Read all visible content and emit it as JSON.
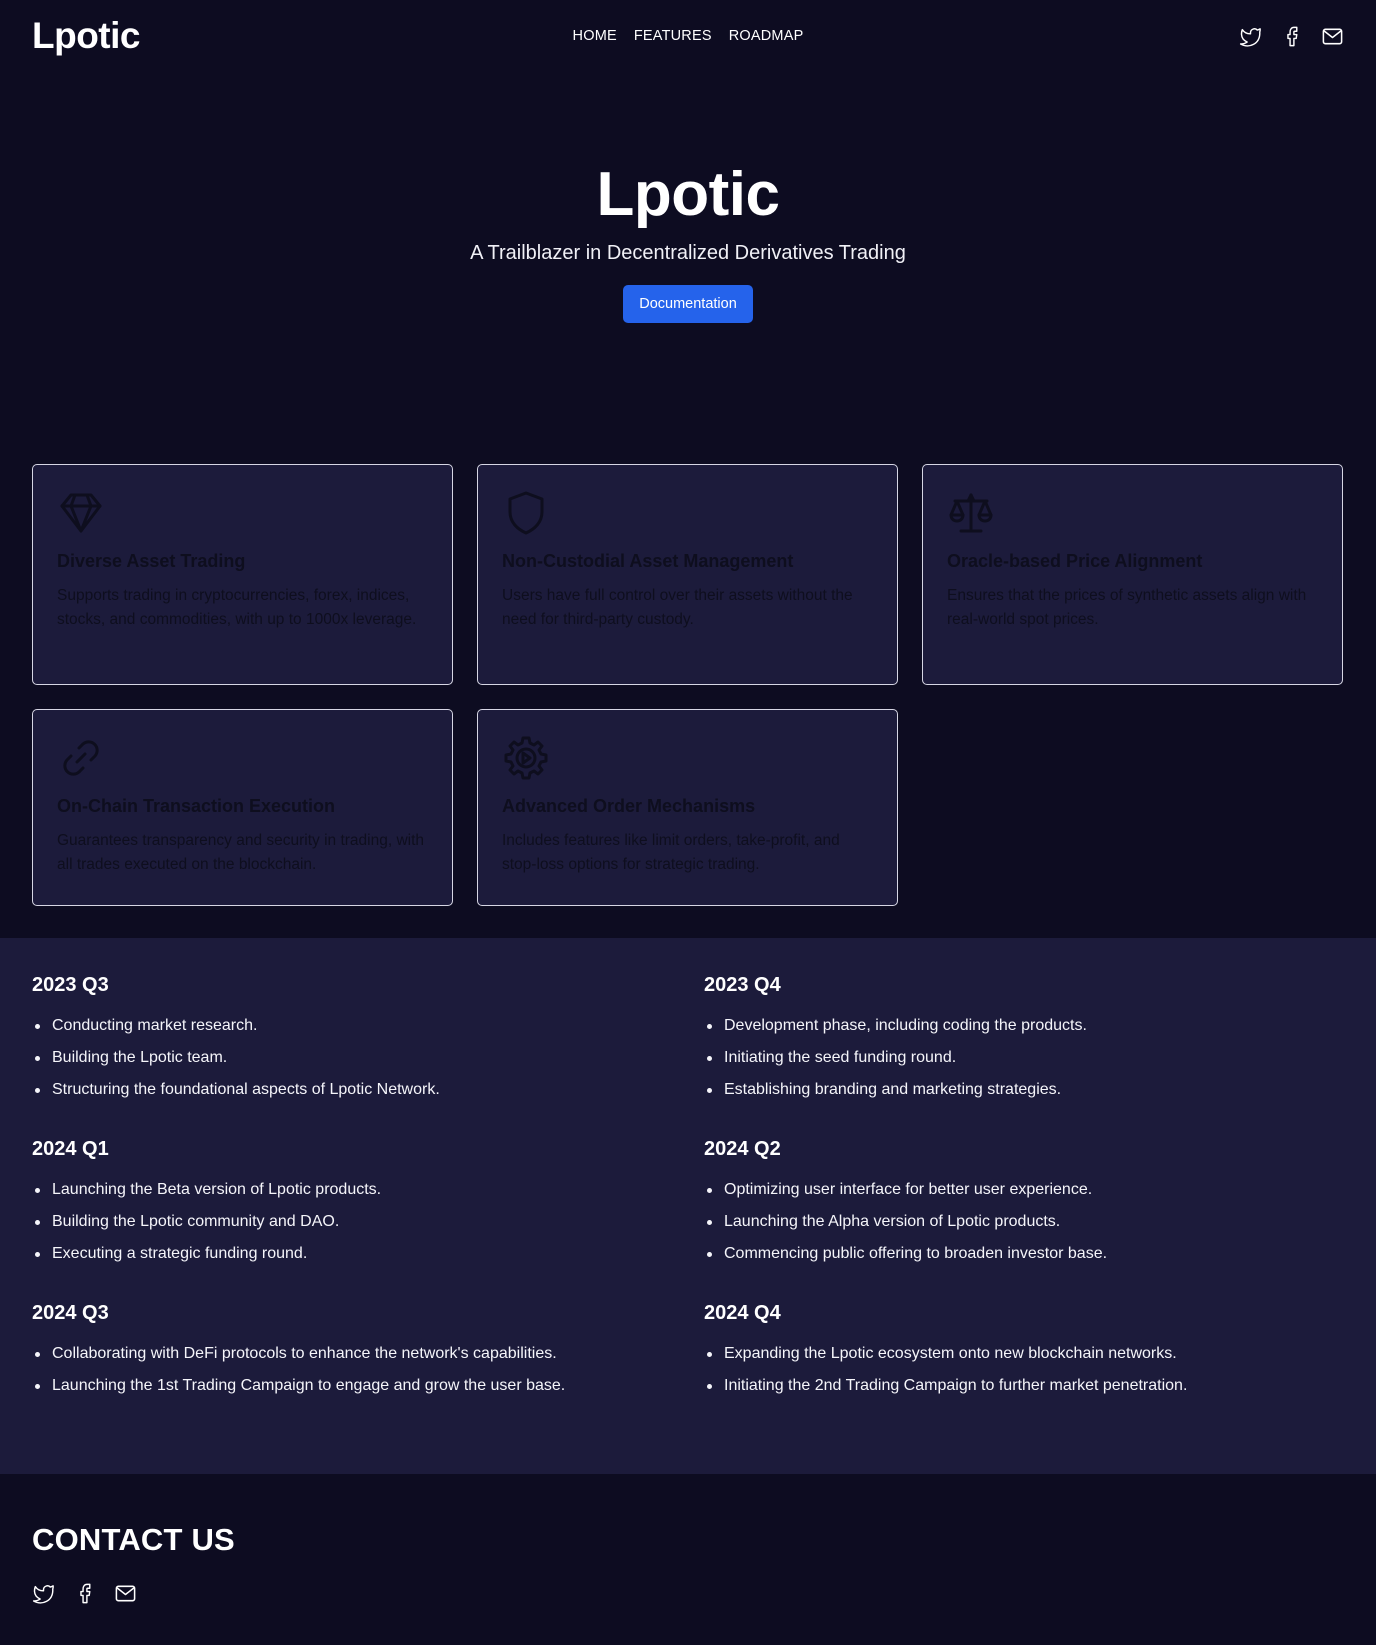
{
  "brand": {
    "logo": "Lpotic"
  },
  "nav": {
    "items": [
      {
        "label": "HOME"
      },
      {
        "label": "FEATURES"
      },
      {
        "label": "ROADMAP"
      }
    ]
  },
  "social_icons": [
    "twitter-icon",
    "facebook-icon",
    "mail-icon"
  ],
  "hero": {
    "title": "Lpotic",
    "subtitle": "A Trailblazer in Decentralized Derivatives Trading",
    "button_label": "Documentation"
  },
  "features": [
    {
      "icon": "diamond-icon",
      "title": "Diverse Asset Trading",
      "description": "Supports trading in cryptocurrencies, forex, indices, stocks, and commodities, with up to 1000x leverage."
    },
    {
      "icon": "shield-icon",
      "title": "Non-Custodial Asset Management",
      "description": "Users have full control over their assets without the need for third-party custody."
    },
    {
      "icon": "scale-icon",
      "title": "Oracle-based Price Alignment",
      "description": "Ensures that the prices of synthetic assets align with real-world spot prices."
    },
    {
      "icon": "link-icon",
      "title": "On-Chain Transaction Execution",
      "description": "Guarantees transparency and security in trading, with all trades executed on the blockchain."
    },
    {
      "icon": "gear-play-icon",
      "title": "Advanced Order Mechanisms",
      "description": "Includes features like limit orders, take-profit, and stop-loss options for strategic trading."
    }
  ],
  "roadmap": [
    {
      "period": "2023 Q3",
      "items": [
        "Conducting market research.",
        "Building the Lpotic team.",
        "Structuring the foundational aspects of Lpotic Network."
      ]
    },
    {
      "period": "2023 Q4",
      "items": [
        "Development phase, including coding the products.",
        "Initiating the seed funding round.",
        "Establishing branding and marketing strategies."
      ]
    },
    {
      "period": "2024 Q1",
      "items": [
        "Launching the Beta version of Lpotic products.",
        "Building the Lpotic community and DAO.",
        "Executing a strategic funding round."
      ]
    },
    {
      "period": "2024 Q2",
      "items": [
        "Optimizing user interface for better user experience.",
        "Launching the Alpha version of Lpotic products.",
        "Commencing public offering to broaden investor base."
      ]
    },
    {
      "period": "2024 Q3",
      "items": [
        "Collaborating with DeFi protocols to enhance the network's capabilities.",
        "Launching the 1st Trading Campaign to engage and grow the user base."
      ]
    },
    {
      "period": "2024 Q4",
      "items": [
        "Expanding the Lpotic ecosystem onto new blockchain networks.",
        "Initiating the 2nd Trading Campaign to further market penetration."
      ]
    }
  ],
  "contact": {
    "title": "CONTACT US"
  },
  "colors": {
    "background": "#0d0c21",
    "surface": "#1c1b3b",
    "accent": "#2563eb",
    "card_text": "#0e0e1e"
  }
}
